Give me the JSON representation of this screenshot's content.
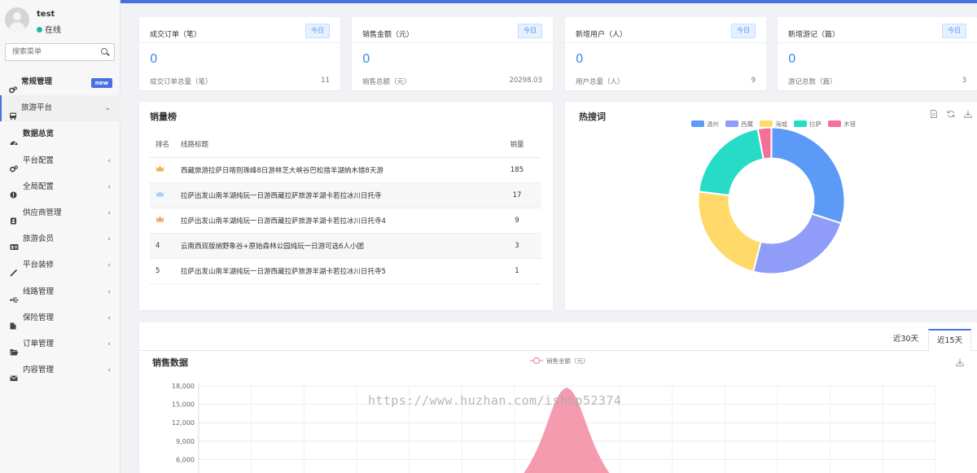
{
  "user": {
    "name": "test",
    "status": "在线"
  },
  "search": {
    "placeholder": "搜索菜单"
  },
  "menu": [
    {
      "label": "常规管理",
      "badge": "new",
      "icon": "gears-icon"
    },
    {
      "label": "旅游平台",
      "icon": "bus-icon",
      "arrow": "⌄"
    },
    {
      "label": "数据总览",
      "icon": "dashboard-icon"
    },
    {
      "label": "平台配置",
      "icon": "gears-icon",
      "arrow": "‹"
    },
    {
      "label": "全局配置",
      "icon": "info-circle-icon",
      "arrow": "‹"
    },
    {
      "label": "供应商管理",
      "icon": "address-book-icon",
      "arrow": "‹"
    },
    {
      "label": "旅游会员",
      "icon": "id-card-icon",
      "arrow": "‹"
    },
    {
      "label": "平台装修",
      "icon": "brush-icon",
      "arrow": "‹"
    },
    {
      "label": "线路管理",
      "icon": "usb-icon",
      "arrow": "‹"
    },
    {
      "label": "保险管理",
      "icon": "file-icon",
      "arrow": "‹"
    },
    {
      "label": "订单管理",
      "icon": "folder-open-icon",
      "arrow": "‹"
    },
    {
      "label": "内容管理",
      "icon": "envelope-icon",
      "arrow": "‹"
    }
  ],
  "stats": [
    {
      "title": "成交订单（笔）",
      "tag": "今日",
      "value": "0",
      "foot": "成交订单总量（笔）",
      "total": "11"
    },
    {
      "title": "销售金额（元）",
      "tag": "今日",
      "value": "0",
      "foot": "销售总额（元）",
      "total": "20298.03"
    },
    {
      "title": "新增用户（人）",
      "tag": "今日",
      "value": "0",
      "foot": "用户总量（人）",
      "total": "9"
    },
    {
      "title": "新增游记（篇）",
      "tag": "今日",
      "value": "0",
      "foot": "游记总数（篇）",
      "total": "3"
    }
  ],
  "ranking": {
    "title": "销量榜",
    "headers": [
      "排名",
      "线路标题",
      "销量"
    ],
    "rows": [
      {
        "rank": "crown-gold",
        "title": "西藏旅游拉萨日喀则珠峰8日游林芝大峡谷巴松措羊湖纳木错8天游",
        "sales": "185"
      },
      {
        "rank": "crown-silver",
        "title": "拉萨出发山南羊湖纯玩一日游西藏拉萨旅游羊湖卡若拉冰川日托寺",
        "sales": "17"
      },
      {
        "rank": "crown-bronze",
        "title": "拉萨出发山南羊湖纯玩一日游西藏拉萨旅游羊湖卡若拉冰川日托寺4",
        "sales": "9"
      },
      {
        "rank": "4",
        "title": "云南西双版纳野象谷+原始森林公园纯玩一日游可选6人小团",
        "sales": "3"
      },
      {
        "rank": "5",
        "title": "拉萨出发山南羊湖纯玩一日游西藏拉萨旅游羊湖卡若拉冰川日托寺5",
        "sales": "1"
      }
    ]
  },
  "hot": {
    "title": "热搜词",
    "chart_data": {
      "type": "pie",
      "donut": true,
      "title": "热搜词",
      "labels": [
        "温州",
        "西藏",
        "海城",
        "拉萨",
        "木错"
      ],
      "values": [
        30,
        24,
        23,
        20,
        3
      ],
      "colors": [
        "#5b9bf7",
        "#8f9cf8",
        "#ffd96a",
        "#26dcc6",
        "#f4709a"
      ],
      "legend": "top"
    }
  },
  "sales": {
    "title": "销售数据",
    "tabs": [
      "近30天",
      "近15天"
    ],
    "active_tab": "近15天",
    "chart_data": {
      "type": "area",
      "series": [
        {
          "name": "销售金额（元）",
          "color": "#f28aa2"
        }
      ],
      "ylabel": "",
      "yticks": [
        "18,000",
        "15,000",
        "12,000",
        "9,000",
        "6,000"
      ],
      "peak": 17700,
      "grid": true,
      "legend": "top"
    }
  },
  "watermark": "https://www.huzhan.com/ishop52374"
}
